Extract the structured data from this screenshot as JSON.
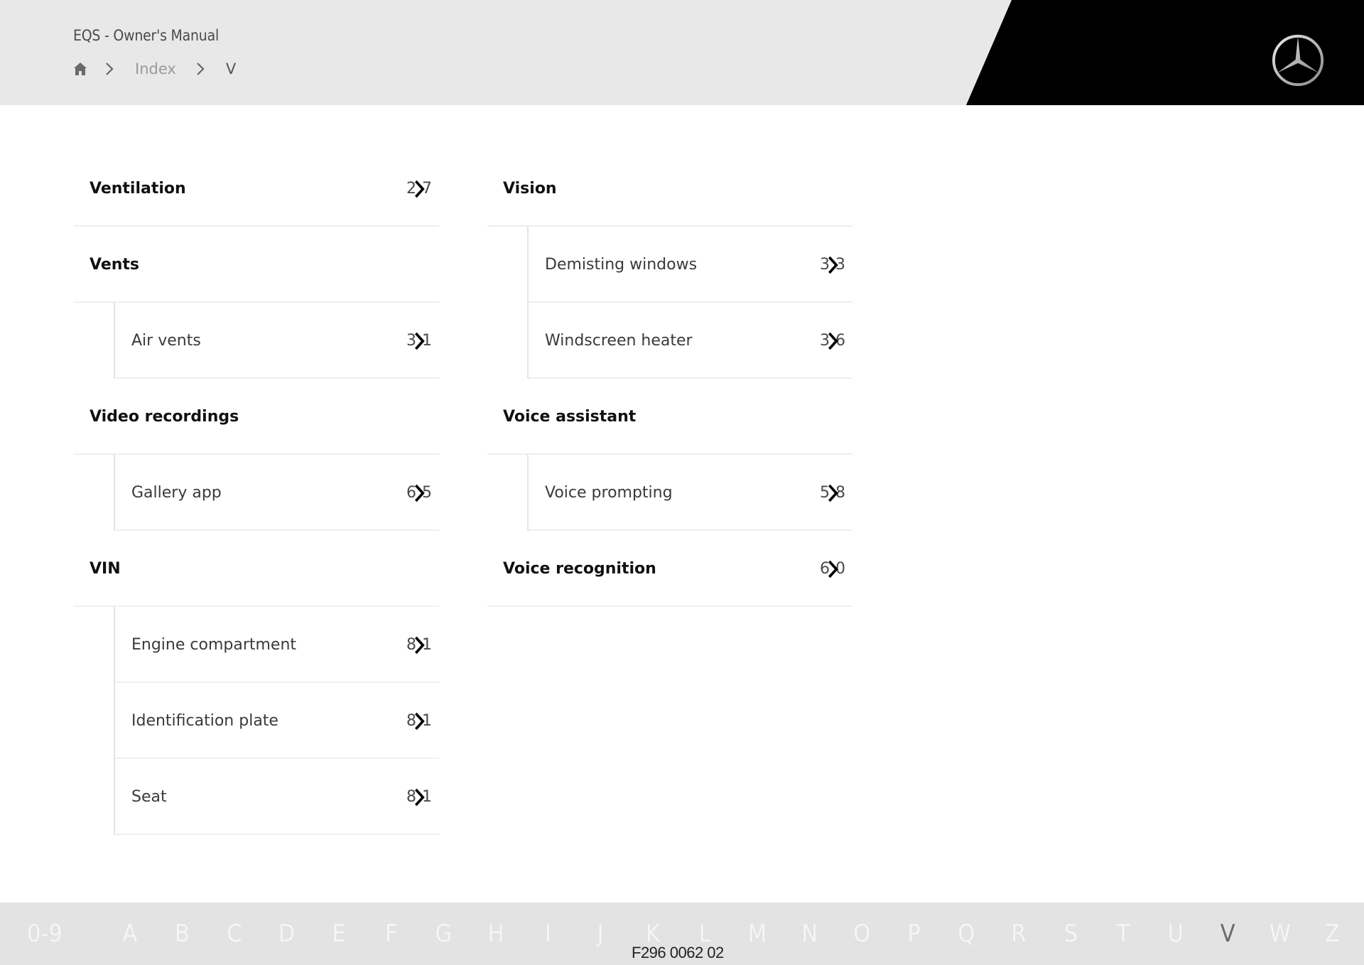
{
  "header": {
    "title": "EQS - Owner's Manual",
    "breadcrumb": {
      "home_icon": "home-icon",
      "separator_icon": "chevron-right-icon",
      "items": [
        "Index",
        "V"
      ]
    },
    "logo": "mercedes-star-logo"
  },
  "index": {
    "left_column": [
      {
        "type": "head",
        "label": "Ventilation",
        "page_first": "2",
        "page_last": "7"
      },
      {
        "type": "head",
        "label": "Vents"
      },
      {
        "type": "sub",
        "label": "Air vents",
        "page_first": "3",
        "page_last": "1"
      },
      {
        "type": "head",
        "label": "Video recordings"
      },
      {
        "type": "sub",
        "label": "Gallery app",
        "page_first": "6",
        "page_last": "5"
      },
      {
        "type": "head",
        "label": "VIN"
      },
      {
        "type": "sub",
        "label": "Engine compartment",
        "page_first": "8",
        "page_last": "1"
      },
      {
        "type": "sub",
        "label": "Identification plate",
        "page_first": "8",
        "page_last": "1"
      },
      {
        "type": "sub",
        "label": "Seat",
        "page_first": "8",
        "page_last": "1"
      }
    ],
    "right_column": [
      {
        "type": "head",
        "label": "Vision"
      },
      {
        "type": "sub",
        "label": "Demisting windows",
        "page_first": "3",
        "page_last": "3"
      },
      {
        "type": "sub",
        "label": "Windscreen heater",
        "page_first": "3",
        "page_last": "6"
      },
      {
        "type": "head",
        "label": "Voice assistant"
      },
      {
        "type": "sub",
        "label": "Voice prompting",
        "page_first": "5",
        "page_last": "8"
      },
      {
        "type": "head",
        "label": "Voice recognition",
        "page_first": "6",
        "page_last": "0"
      }
    ]
  },
  "alphabet_bar": {
    "letters": [
      "0-9",
      "A",
      "B",
      "C",
      "D",
      "E",
      "F",
      "G",
      "H",
      "I",
      "J",
      "K",
      "L",
      "M",
      "N",
      "O",
      "P",
      "Q",
      "R",
      "S",
      "T",
      "U",
      "V",
      "W",
      "Z"
    ],
    "active": "V"
  },
  "footer": {
    "document_id": "F296 0062 02"
  },
  "colors": {
    "header_bg": "#e8e8e8",
    "brand_black": "#000000",
    "alphabet_bg": "#e3e3e3",
    "active_letter": "#6a6a6a"
  }
}
